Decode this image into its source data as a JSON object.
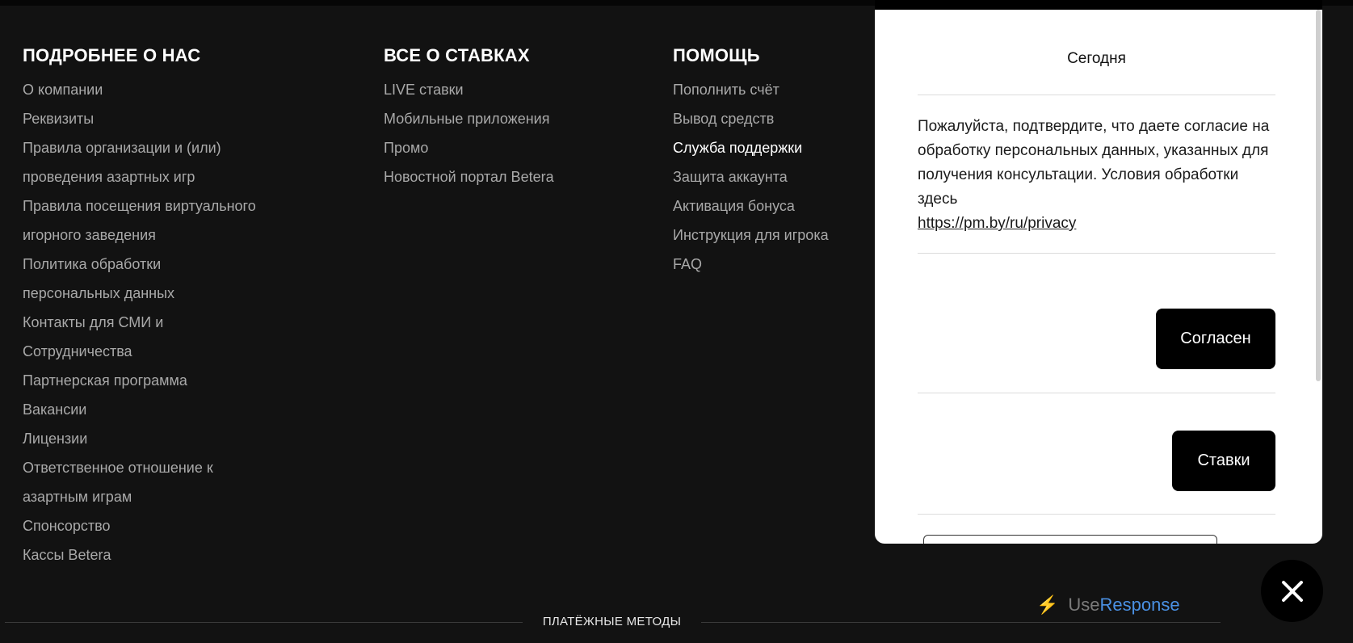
{
  "footer": {
    "columns": [
      {
        "title": "ПОДРОБНЕЕ О НАС",
        "links": [
          "О компании",
          "Реквизиты",
          "Правила организации и (или)",
          "проведения азартных игр",
          "Правила посещения виртуального",
          "игорного заведения",
          "Политика обработки",
          "персональных данных",
          "Контакты для СМИ и",
          "Сотрудничества",
          "Партнерская программа",
          "Вакансии",
          "Лицензии",
          "Ответственное отношение к",
          "азартным играм",
          "Спонсорство",
          "Кассы Betera"
        ]
      },
      {
        "title": "ВСЕ О СТАВКАХ",
        "links": [
          "LIVE ставки",
          "Мобильные приложения",
          "Промо",
          "Новостной портал Betera"
        ]
      },
      {
        "title": "ПОМОЩЬ",
        "links": [
          "Пополнить счёт",
          "Вывод средств",
          "Служба поддержки",
          "Защита аккаунта",
          "Активация бонуса",
          "Инструкция для игрока",
          "FAQ"
        ],
        "active_link": "Служба поддержки"
      }
    ],
    "payments_title": "ПЛАТЁЖНЫЕ МЕТОДЫ"
  },
  "chat": {
    "date_label": "Сегодня",
    "message_text": "Пожалуйста, подтвердите, что даете согласие на обработку персональных данных, указанных для получения консультации. Условия обработки здесь",
    "message_link": "https://pm.by/ru/privacy",
    "agree_button": "Согласен",
    "bets_button": "Ставки"
  },
  "widget": {
    "brand_use": "Use",
    "brand_response": "Response",
    "close_icon": "close-icon",
    "bolt_icon": "lightning-icon"
  },
  "colors": {
    "background": "#121212",
    "link": "#a9a9a9",
    "brand_blue": "#4a90e2",
    "bolt": "#e6a100"
  }
}
